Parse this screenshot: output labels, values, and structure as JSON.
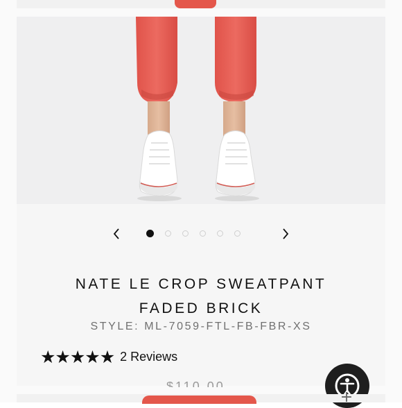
{
  "product": {
    "title_line1": "NATE LE CROP SWEATPANT",
    "title_line2": "FADED BRICK",
    "style": "STYLE: ML-7059-FTL-FB-FBR-XS",
    "rating_stars": 5,
    "reviews_label": "2 Reviews",
    "price_partial": "$110.00"
  },
  "carousel": {
    "prev_icon": "chevron-left-icon",
    "next_icon": "chevron-right-icon",
    "slide_count": 6,
    "active_index": 0
  },
  "colors": {
    "accent": "#e4574b",
    "fab": "#1e1e1e"
  },
  "fab": {
    "icon": "accessibility-icon"
  },
  "add_button": {
    "label": "+"
  }
}
